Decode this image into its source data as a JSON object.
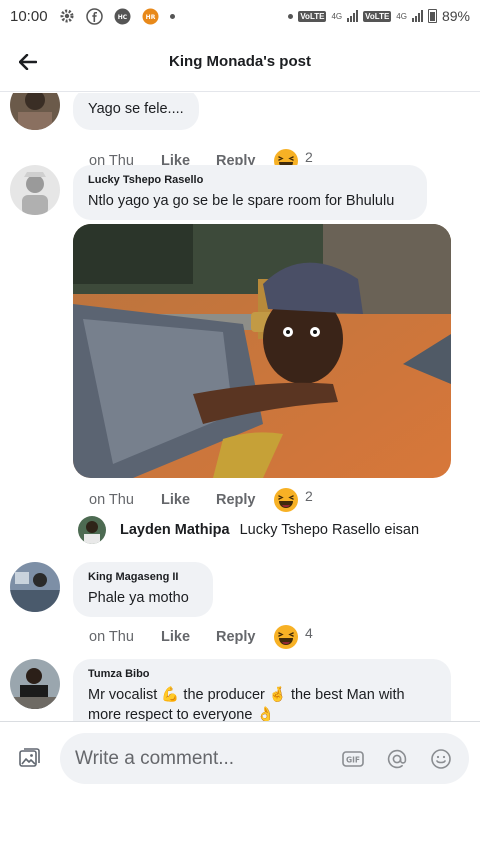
{
  "status_bar": {
    "time": "10:00",
    "battery": "89%",
    "network_label": "VoLTE",
    "network_type": "4G"
  },
  "header": {
    "title": "King Monada's post"
  },
  "comments": [
    {
      "text": "Yago se fele....",
      "time": "on Thu",
      "like": "Like",
      "reply": "Reply",
      "reaction_count": "2"
    },
    {
      "author": "Lucky Tshepo Rasello",
      "text": "Ntlo yago ya go se be le spare room for Bhululu",
      "time": "on Thu",
      "like": "Like",
      "reply": "Reply",
      "reaction_count": "2",
      "reply_preview": {
        "author": "Layden Mathipa",
        "text": "Lucky Tshepo Rasello eisan"
      }
    },
    {
      "author": "King  Magaseng II",
      "text": "Phale ya motho",
      "time": "on Thu",
      "like": "Like",
      "reply": "Reply",
      "reaction_count": "4"
    },
    {
      "author": "Tumza Bibo",
      "text_part1": "Mr vocalist",
      "text_part2": "the producer",
      "text_part3": "the best Man with",
      "text_line2": "more respect to everyone"
    }
  ],
  "composer": {
    "placeholder": "Write a comment..."
  },
  "icons": {
    "back": "arrow-left-icon",
    "photo": "photo-icon",
    "gif": "gif-icon",
    "mention": "at-sign-icon",
    "emoji": "smiley-icon",
    "reaction": "haha-reaction-icon"
  },
  "colors": {
    "bubble": "#f0f2f5",
    "text": "#1c1e21",
    "secondary": "#65676b",
    "reaction": "#f7b125"
  }
}
